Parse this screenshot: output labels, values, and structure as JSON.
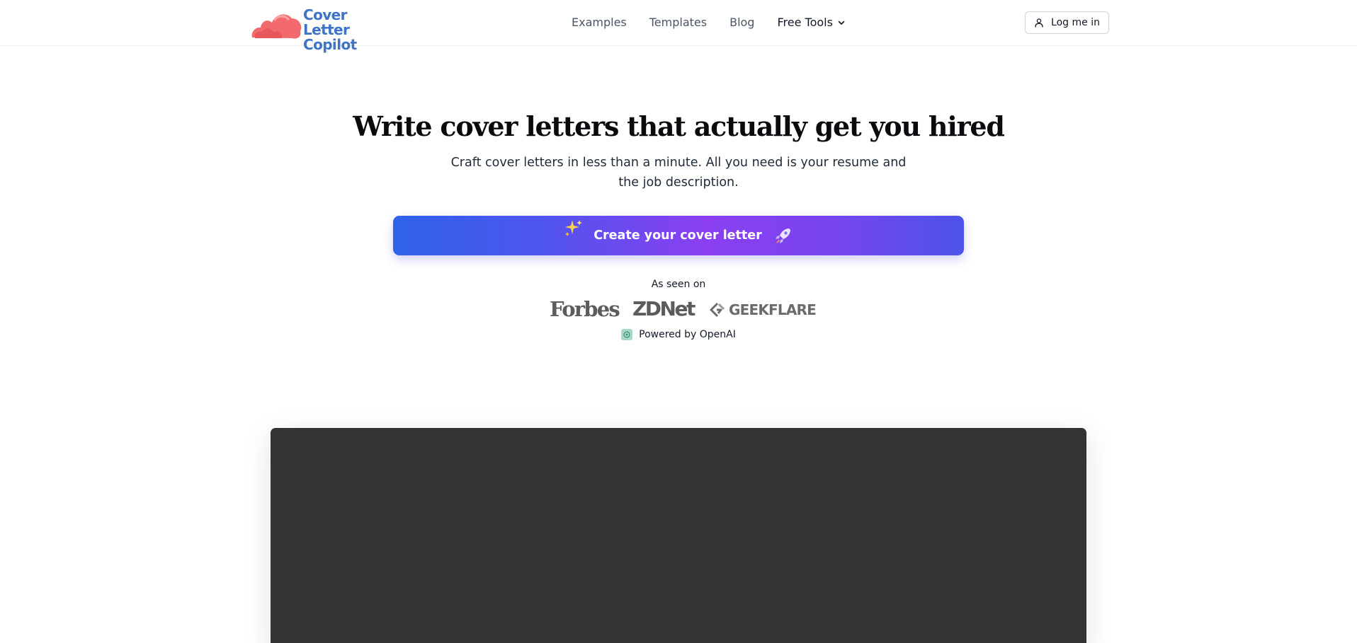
{
  "header": {
    "logo": {
      "line1": "Cover Letter",
      "line2": "Copilot",
      "text_color": "#3f73c8",
      "mark_color": "#f26a6d"
    },
    "nav": [
      {
        "label": "Examples"
      },
      {
        "label": "Templates"
      },
      {
        "label": "Blog"
      },
      {
        "label": "Free Tools",
        "icon": "chevron-down-icon"
      }
    ],
    "login_label": "Log me in"
  },
  "hero": {
    "title": "Write cover letters that actually get you hired",
    "subtitle": "Craft cover letters in less than a minute. All you need is your resume and the job description.",
    "cta_label": "Create your cover letter",
    "cta_icon_left": "sparkles-icon",
    "cta_icon_right": "rocket-icon",
    "cta_gradient": [
      "#2f63ea",
      "#8a3ff0",
      "#4d53ea"
    ]
  },
  "press": {
    "heading": "As seen on",
    "logos": [
      "Forbes",
      "ZDNet",
      "GEEKFLARE"
    ]
  },
  "powered_by": "Powered by OpenAI",
  "video": {
    "background": "#333333"
  }
}
